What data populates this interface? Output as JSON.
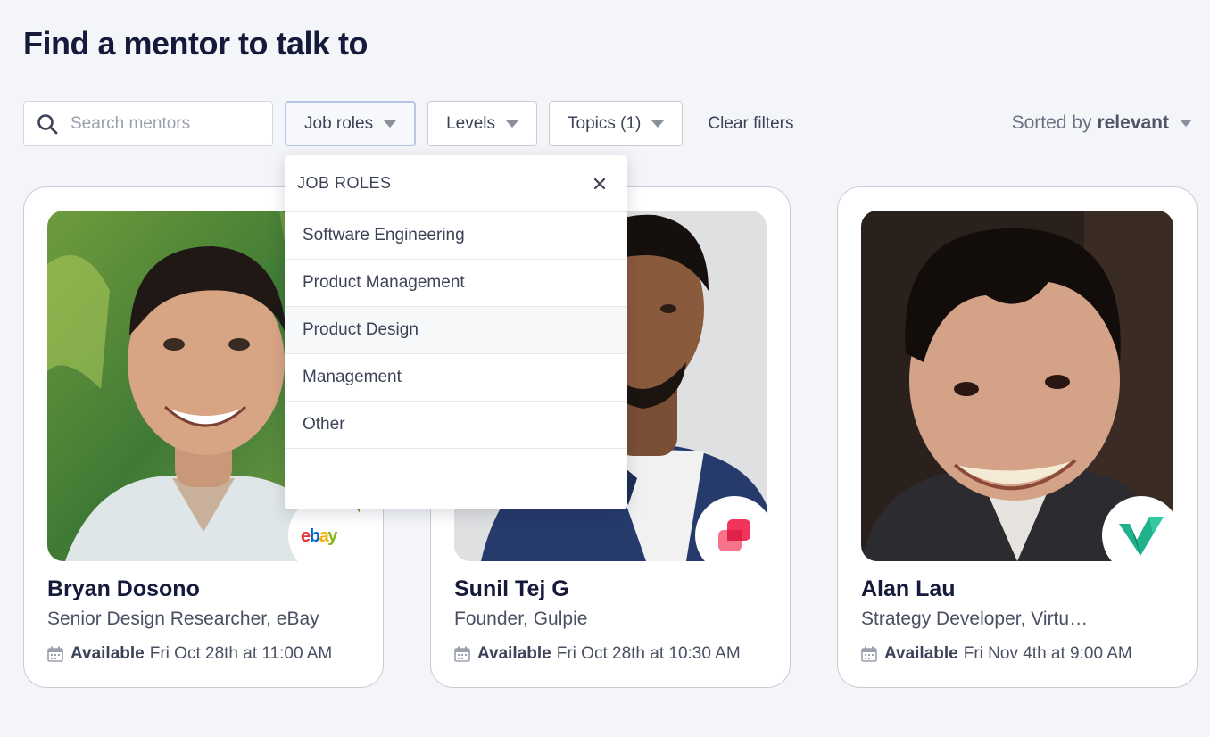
{
  "page": {
    "title": "Find a mentor to talk to"
  },
  "filters": {
    "search_placeholder": "Search mentors",
    "job_roles": "Job roles",
    "levels": "Levels",
    "topics": "Topics (1)",
    "clear": "Clear filters"
  },
  "sort": {
    "prefix": "Sorted by",
    "value": "relevant"
  },
  "dropdown": {
    "title": "JOB ROLES",
    "items": [
      "Software Engineering",
      "Product Management",
      "Product Design",
      "Management",
      "Other"
    ]
  },
  "mentors": [
    {
      "name": "Bryan Dosono",
      "role": "Senior Design Researcher, eBay",
      "available_label": "Available",
      "available_time": "Fri Oct 28th at 11:00 AM",
      "logo_text": "ebay"
    },
    {
      "name": "Sunil Tej G",
      "role": "Founder, Gulpie",
      "available_label": "Available",
      "available_time": "Fri Oct 28th at 10:30 AM"
    },
    {
      "name": "Alan Lau",
      "role": "Strategy Developer, Virtu…",
      "available_label": "Available",
      "available_time": "Fri Nov 4th at 9:00 AM"
    }
  ],
  "colors": {
    "background": "#f4f5f9",
    "title": "#151a3b",
    "gulpie": "#f0345a",
    "virtu": "#1fb08c"
  }
}
